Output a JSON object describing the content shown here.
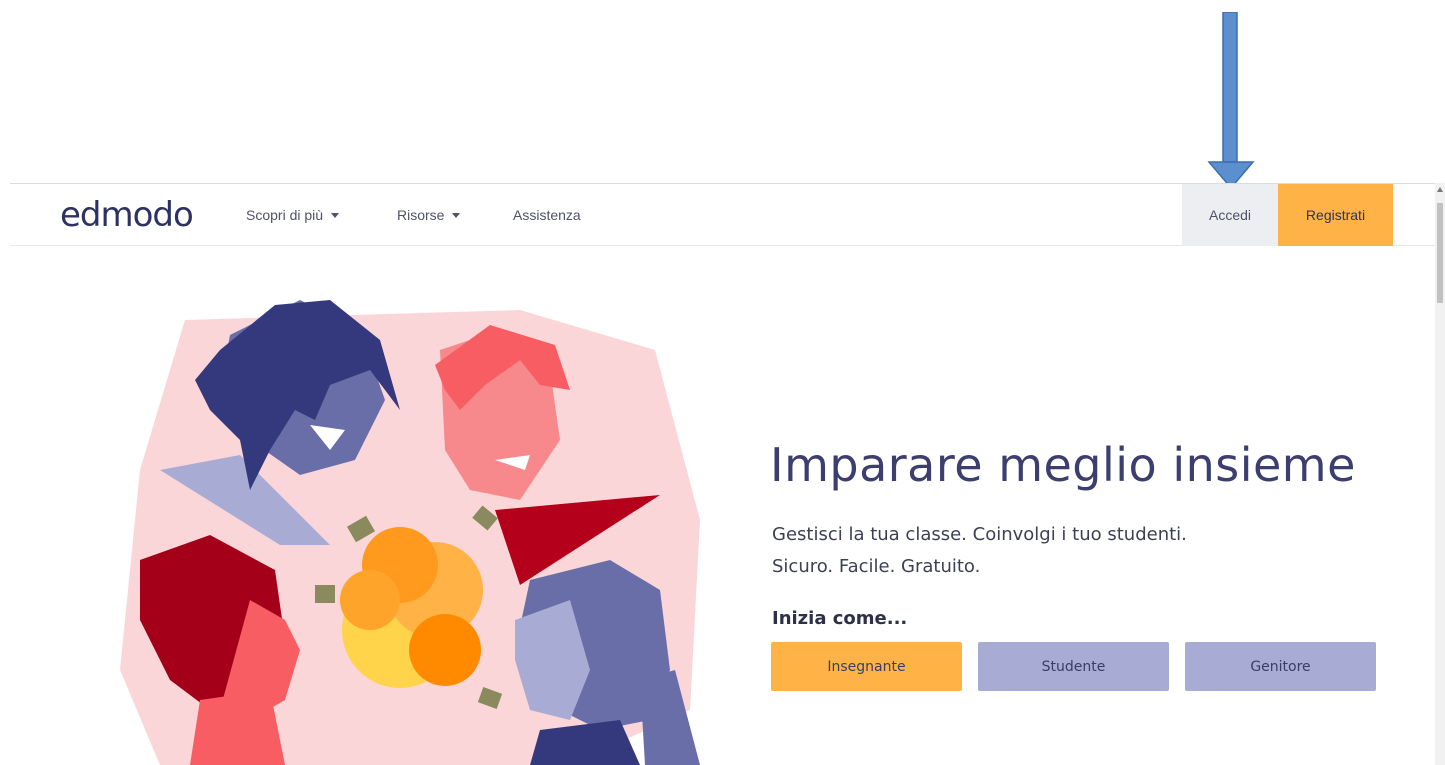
{
  "nav": {
    "logo": "edmodo",
    "items": [
      {
        "label": "Scopri di più"
      },
      {
        "label": "Risorse"
      },
      {
        "label": "Assistenza"
      }
    ],
    "login": "Accedi",
    "signup": "Registrati"
  },
  "hero": {
    "headline": "Imparare meglio insieme",
    "sub1": "Gestisci la tua classe. Coinvolgi i tuo studenti.",
    "sub2": "Sicuro. Facile. Gratuito.",
    "start_as": "Inizia come...",
    "roles": [
      "Insegnante",
      "Studente",
      "Genitore"
    ]
  },
  "colors": {
    "accent": "#ffb347",
    "secondary": "#a8abd3",
    "brand": "#2d3263",
    "arrow": "#5b8fcf"
  },
  "icons": [
    "down-arrow-annotation-icon",
    "caret-down-icon"
  ]
}
